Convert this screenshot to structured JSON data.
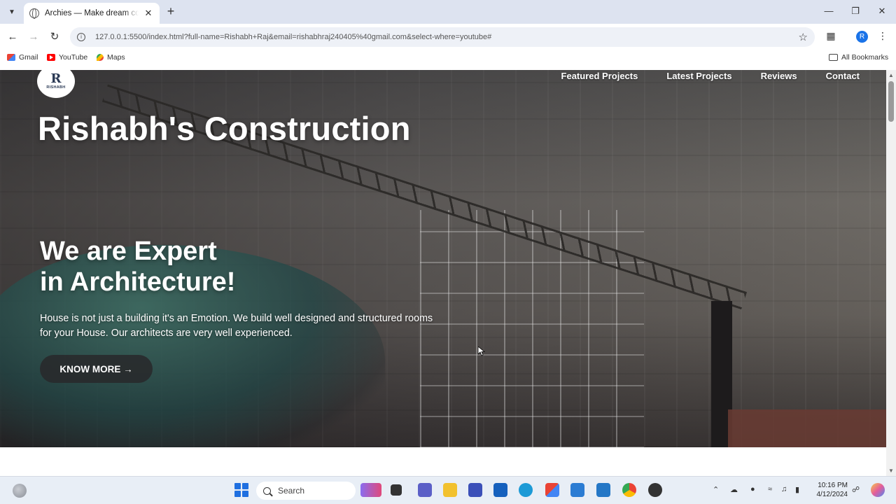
{
  "browser": {
    "tab_title": "Archies — Make dream come true",
    "url": "127.0.0.1:5500/index.html?full-name=Rishabh+Raj&email=rishabhraj240405%40gmail.com&select-where=youtube#",
    "profile_initial": "R",
    "bookmarks": [
      "Gmail",
      "YouTube",
      "Maps"
    ],
    "all_bookmarks": "All Bookmarks"
  },
  "site": {
    "logo_mark": "R",
    "logo_text": "RISHABH",
    "nav": [
      "Featured Projects",
      "Latest Projects",
      "Reviews",
      "Contact"
    ],
    "brand_title": "Rishabh's Construction",
    "headline_line1": "We are Expert",
    "headline_line2": "in Architecture!",
    "description": "House is not just a building it's an Emotion. We build well designed and structured rooms for your House. Our architects are very well experienced.",
    "cta_label": "KNOW MORE →"
  },
  "taskbar": {
    "search_placeholder": "Search",
    "time": "10:16 PM",
    "date": "4/12/2024"
  },
  "colors": {
    "chrome_tab_strip": "#dde3f0",
    "omnibox": "#eef1f7",
    "accent_blue": "#1a73e8",
    "cta_bg": "#28282a",
    "taskbar": "#e8eef6"
  },
  "icons": [
    "tab-search-icon",
    "globe-icon",
    "close-icon",
    "new-tab-icon",
    "minimize-icon",
    "restore-icon",
    "back-icon",
    "forward-icon",
    "reload-icon",
    "site-info-icon",
    "bookmark-star-icon",
    "extensions-icon",
    "menu-kebab-icon",
    "folder-icon",
    "windows-start-icon",
    "search-icon"
  ]
}
